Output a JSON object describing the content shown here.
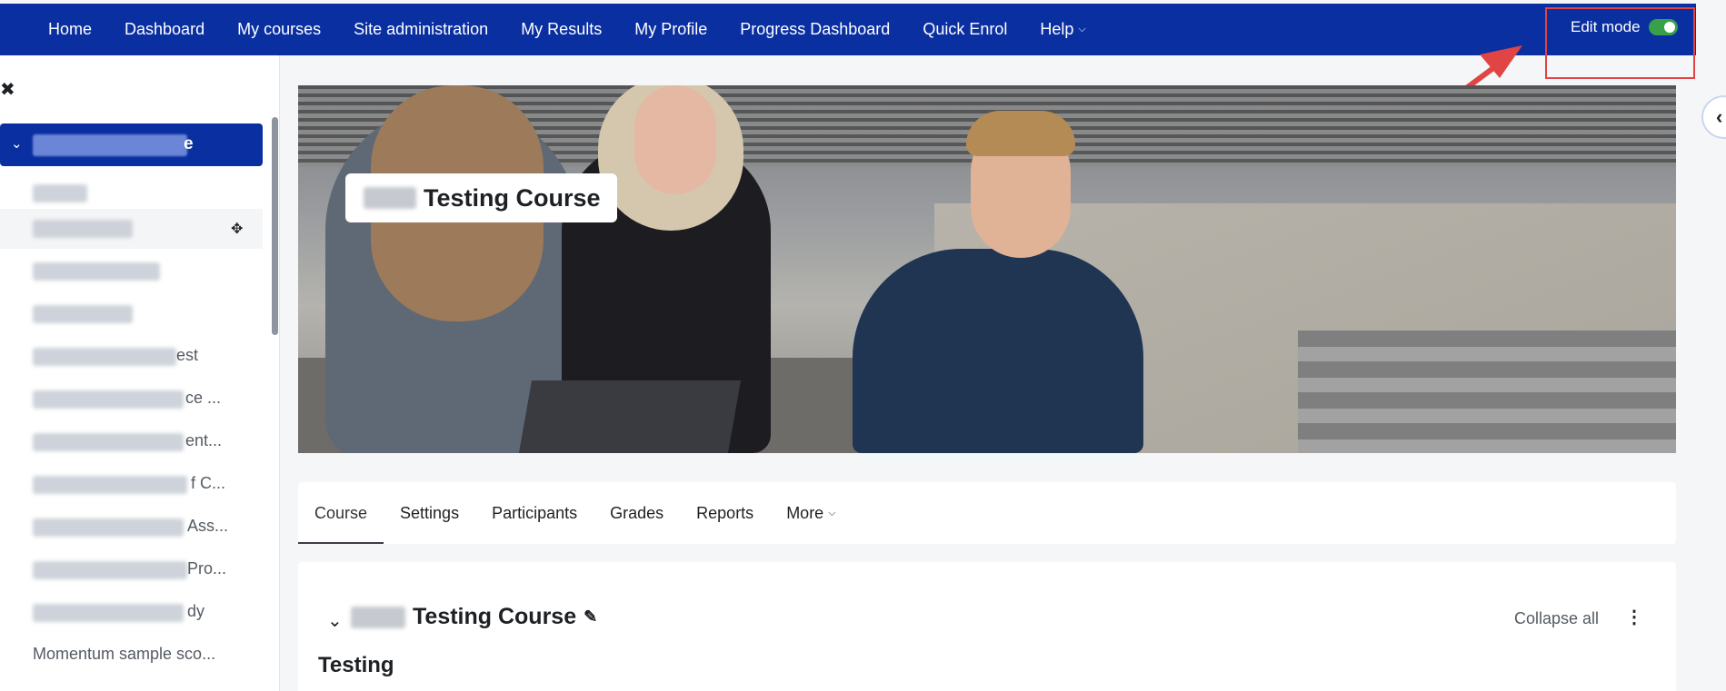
{
  "topnav": {
    "items": [
      "Home",
      "Dashboard",
      "My courses",
      "Site administration",
      "My Results",
      "My Profile",
      "Progress Dashboard",
      "Quick Enrol",
      "Help"
    ],
    "edit_mode_label": "Edit mode",
    "edit_mode_on": true
  },
  "drawer": {
    "course_item_suffix": "e",
    "items": [
      {
        "text": ""
      },
      {
        "text": ""
      },
      {
        "text": ""
      },
      {
        "text": ""
      },
      {
        "text": "est"
      },
      {
        "text": "ce ..."
      },
      {
        "text": "ent..."
      },
      {
        "text": "f C..."
      },
      {
        "text": "Ass..."
      },
      {
        "text": "Pro..."
      },
      {
        "text": "dy"
      },
      {
        "text": "Momentum sample sco..."
      }
    ]
  },
  "hero": {
    "title": "Testing Course"
  },
  "secondary_nav": {
    "items": [
      "Course",
      "Settings",
      "Participants",
      "Grades",
      "Reports",
      "More"
    ],
    "active": "Course"
  },
  "content": {
    "section_title": "Testing Course",
    "collapse_all": "Collapse all",
    "subtitle": "Testing"
  },
  "colors": {
    "brand": "#0a2fa0",
    "toggle_on": "#39a04a",
    "annotation": "#e04444"
  },
  "icons": [
    "chevron-down-icon",
    "close-icon",
    "move-icon",
    "pencil-icon",
    "kebab-icon",
    "chevron-left-icon"
  ]
}
